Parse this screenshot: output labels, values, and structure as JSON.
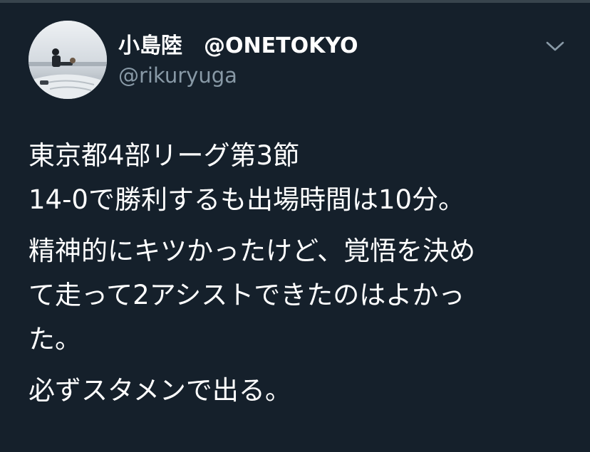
{
  "tweet": {
    "display_name": "小島陸　@ONETOKYO",
    "handle": "@rikuryuga",
    "paragraphs": [
      {
        "lines": [
          "東京都4部リーグ第3節",
          "14-0で勝利するも出場時間は10分。"
        ]
      },
      {
        "lines": [
          "精神的にキツかったけど、覚悟を決め",
          "て走って2アシストできたのはよかっ",
          "た。"
        ]
      },
      {
        "lines": [
          "必ずスタメンで出る。"
        ]
      }
    ]
  },
  "icons": {
    "menu": "chevron-down-icon",
    "avatar": "user-avatar-photo"
  },
  "colors": {
    "background": "#15202b",
    "primary_text": "#ffffff",
    "secondary_text": "#8899a6",
    "divider": "#38444d"
  }
}
